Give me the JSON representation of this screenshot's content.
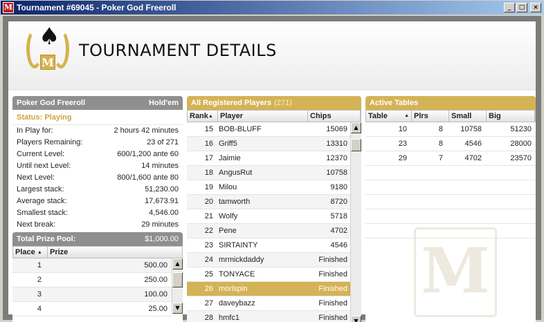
{
  "window": {
    "title": "Tournament #69045 - Poker God Freeroll",
    "minimize": "_",
    "maximize": "□",
    "close": "×"
  },
  "header": {
    "title": "TOURNAMENT DETAILS",
    "logo_letter": "M",
    "spade": "♠"
  },
  "info": {
    "name": "Poker God Freeroll",
    "game": "Hold'em",
    "status": "Status: Playing",
    "rows": [
      {
        "label": "In Play for:",
        "value": "2 hours 42 minutes"
      },
      {
        "label": "Players Remaining:",
        "value": "23 of 271"
      },
      {
        "label": "Current Level:",
        "value": "600/1,200 ante 60"
      },
      {
        "label": "Until next Level:",
        "value": "14 minutes"
      },
      {
        "label": "Next Level:",
        "value": "800/1,600 ante 80"
      },
      {
        "label": "Largest stack:",
        "value": "51,230.00"
      },
      {
        "label": "Average stack:",
        "value": "17,673.91"
      },
      {
        "label": "Smallest stack:",
        "value": "4,546.00"
      },
      {
        "label": "Next break:",
        "value": "29 minutes"
      }
    ]
  },
  "prize_pool": {
    "label": "Total Prize Pool:",
    "value": "$1,000.00",
    "columns": [
      "Place",
      "Prize"
    ],
    "rows": [
      {
        "place": "1",
        "prize": "500.00"
      },
      {
        "place": "2",
        "prize": "250.00"
      },
      {
        "place": "3",
        "prize": "100.00"
      },
      {
        "place": "4",
        "prize": "25.00"
      }
    ]
  },
  "players": {
    "title": "All Registered Players",
    "count": "(271)",
    "columns": [
      "Rank",
      "Player",
      "Chips"
    ],
    "selected_rank": "26",
    "rows": [
      {
        "rank": "15",
        "player": "BOB-BLUFF",
        "chips": "15069"
      },
      {
        "rank": "16",
        "player": "Griff5",
        "chips": "13310"
      },
      {
        "rank": "17",
        "player": "Jaimie",
        "chips": "12370"
      },
      {
        "rank": "18",
        "player": "AngusRut",
        "chips": "10758"
      },
      {
        "rank": "19",
        "player": "Milou",
        "chips": "9180"
      },
      {
        "rank": "20",
        "player": "tamworth",
        "chips": "8720"
      },
      {
        "rank": "21",
        "player": "Wolfy",
        "chips": "5718"
      },
      {
        "rank": "22",
        "player": "Pene",
        "chips": "4702"
      },
      {
        "rank": "23",
        "player": "SIRTAINTY",
        "chips": "4546"
      },
      {
        "rank": "24",
        "player": "mrmickdaddy",
        "chips": "Finished"
      },
      {
        "rank": "25",
        "player": "TONYACE",
        "chips": "Finished"
      },
      {
        "rank": "26",
        "player": "morlspin",
        "chips": "Finished"
      },
      {
        "rank": "27",
        "player": "daveybazz",
        "chips": "Finished"
      },
      {
        "rank": "28",
        "player": "hmfc1",
        "chips": "Finished"
      }
    ]
  },
  "tables": {
    "title": "Active Tables",
    "columns": [
      "Table",
      "Plrs",
      "Small",
      "Big"
    ],
    "rows": [
      {
        "table": "10",
        "plrs": "8",
        "small": "10758",
        "big": "51230"
      },
      {
        "table": "23",
        "plrs": "8",
        "small": "4546",
        "big": "28000"
      },
      {
        "table": "29",
        "plrs": "7",
        "small": "4702",
        "big": "23570"
      }
    ],
    "watermark": "M"
  },
  "colors": {
    "gold": "#d4b356",
    "grey_header": "#8f8f8f",
    "title_bar": "#0a246a"
  }
}
